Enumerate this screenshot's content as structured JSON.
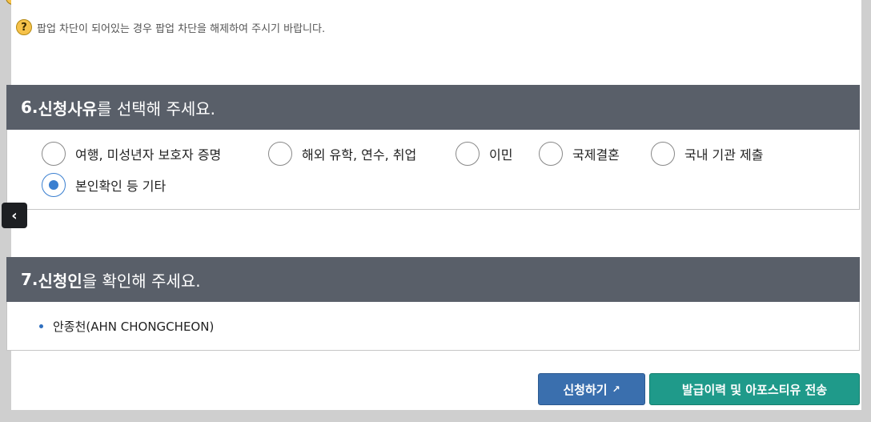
{
  "notice": {
    "icon": "help-icon",
    "text": "팝업 차단이 되어있는 경우 팝업 차단을 해제하여 주시기 바랍니다."
  },
  "section6": {
    "title_number": "6. ",
    "title_bold": "신청사유",
    "title_rest": "를 선택해 주세요.",
    "options": [
      {
        "label": "여행, 미성년자 보호자 증명",
        "checked": false
      },
      {
        "label": "해외 유학, 연수, 취업",
        "checked": false
      },
      {
        "label": "이민",
        "checked": false
      },
      {
        "label": "국제결혼",
        "checked": false
      },
      {
        "label": "국내 기관 제출",
        "checked": false
      },
      {
        "label": "본인확인 등 기타",
        "checked": true
      }
    ]
  },
  "section7": {
    "title_number": "7. ",
    "title_bold": "신청인",
    "title_rest": "을 확인해 주세요.",
    "applicant": "안종천(AHN CHONGCHEON)"
  },
  "buttons": {
    "apply": "신청하기",
    "apply_icon": "external-link-icon",
    "history": "발급이력 및 아포스티유 전송"
  },
  "colors": {
    "header_bg": "#595f69",
    "radio_accent": "#3a7fd0",
    "apply_btn": "#3a6fae",
    "history_btn": "#1f9a8a"
  }
}
